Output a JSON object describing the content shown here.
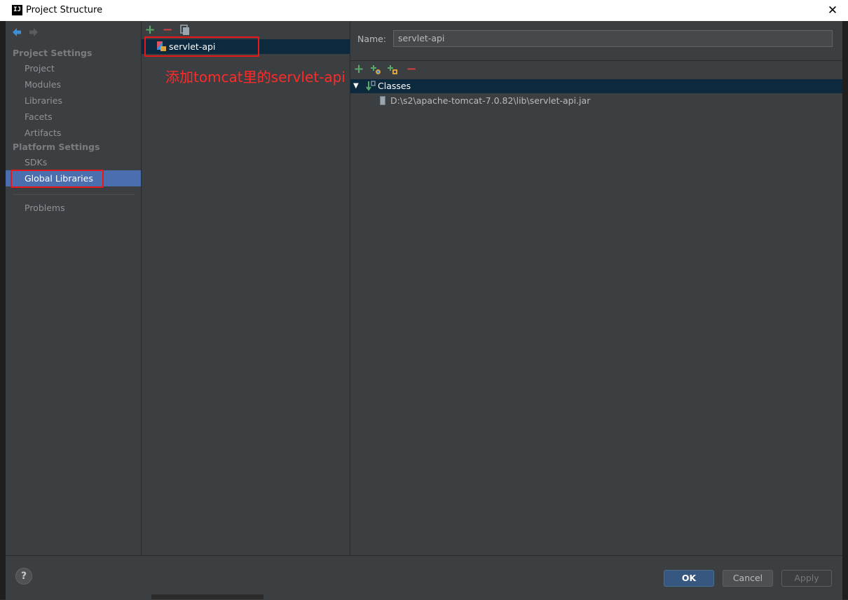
{
  "window": {
    "title": "Project Structure",
    "app_icon": "IJ",
    "close_glyph": "✕"
  },
  "sidebar": {
    "sections": [
      {
        "header": "Project Settings",
        "items": [
          "Project",
          "Modules",
          "Libraries",
          "Facets",
          "Artifacts"
        ]
      },
      {
        "header": "Platform Settings",
        "items": [
          "SDKs",
          "Global Libraries"
        ]
      }
    ],
    "extra_items": [
      "Problems"
    ],
    "selected_item": "Global Libraries"
  },
  "library_list": {
    "toolbar": {
      "add": "+",
      "remove": "−",
      "copy_icon": "copy-icon"
    },
    "items": [
      {
        "label": "servlet-api",
        "selected": true
      }
    ]
  },
  "annotation": {
    "text": "添加tomcat里的servlet-api",
    "color": "#ff2a2a"
  },
  "detail": {
    "name_label": "Name:",
    "name_value": "servlet-api",
    "toolbar": {
      "add": "+",
      "remove": "−"
    },
    "tree": {
      "root_label": "Classes",
      "children": [
        "D:\\s2\\apache-tomcat-7.0.82\\lib\\servlet-api.jar"
      ]
    }
  },
  "footer": {
    "help_label": "?",
    "ok_label": "OK",
    "cancel_label": "Cancel",
    "apply_label": "Apply"
  },
  "colors": {
    "selection_sidebar": "#4b6eaf",
    "selection_list": "#0d293e",
    "panel_bg": "#3c3f41",
    "add_green": "#59a869",
    "remove_red": "#d04040",
    "highlight_box": "#e8181a"
  }
}
